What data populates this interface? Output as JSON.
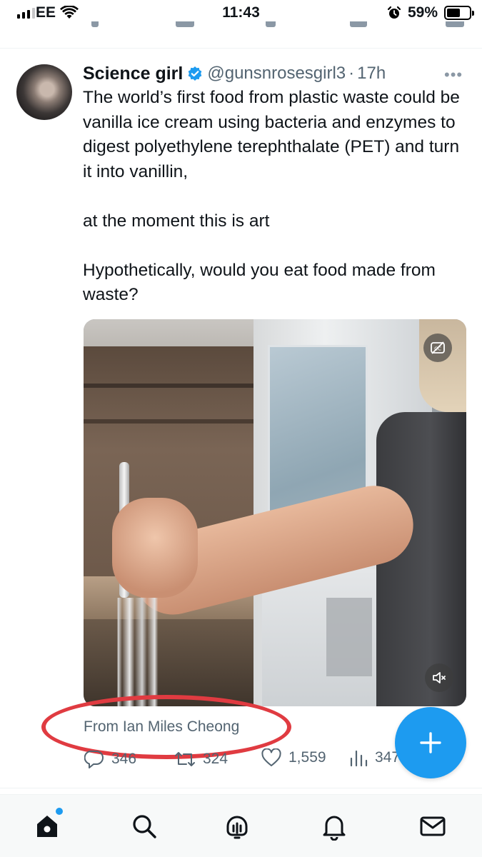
{
  "status_bar": {
    "carrier": "EE",
    "time": "11:43",
    "battery": "59%",
    "battery_level": 0.59
  },
  "tweet": {
    "display_name": "Science girl",
    "handle": "@gunsnrosesgirl3",
    "separator": "·",
    "time_ago": "17h",
    "more": "•••",
    "text": "The world’s first food from plastic waste could be vanilla ice cream using  bacteria and enzymes to digest polyethylene terephthalate (PET) and turn it into vanillin,\n\nat the moment this is art\n\nHypothetically, would you eat food made from waste?",
    "source": "From Ian Miles Cheong"
  },
  "engagement": {
    "replies": "346",
    "retweets": "324",
    "likes": "1,559",
    "views": "347"
  },
  "colors": {
    "accent": "#1d9bf0",
    "highlight_ring": "#e03b41",
    "secondary_text": "#536471"
  },
  "icons": {
    "verified": "verified-badge-icon",
    "captions": "captions-off-icon",
    "mute": "muted-speaker-icon",
    "compose": "plus-icon",
    "nav": [
      "home-icon",
      "search-icon",
      "spaces-icon",
      "bell-icon",
      "mail-icon"
    ]
  }
}
